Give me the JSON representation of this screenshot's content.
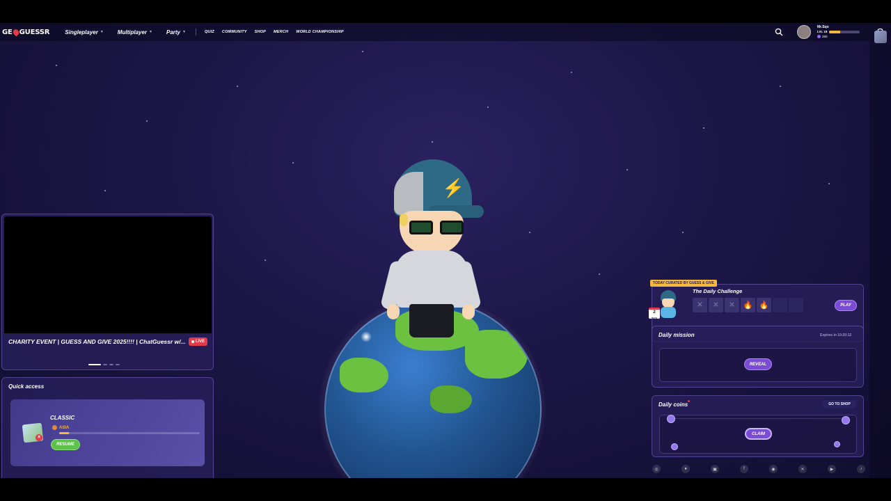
{
  "nav": {
    "logo": "GEOGUESSR",
    "main": [
      "Singleplayer",
      "Multiplayer",
      "Party"
    ],
    "sub": [
      "QUIZ",
      "COMMUNITY",
      "SHOP",
      "MERCH",
      "WORLD CHAMPIONSHIP"
    ]
  },
  "profile": {
    "name": "Mr.Sqo",
    "level": "LVL 18",
    "coins": "260",
    "level_progress": 0.35
  },
  "stream": {
    "title": "CHARITY EVENT | GUESS AND GIVE 2025!!!! | ChatGuessr w/...",
    "live_label": "LIVE"
  },
  "quick_access": {
    "label": "Quick access",
    "card": {
      "title": "CLASSIC",
      "region": "ASIA",
      "resume_label": "RESUME",
      "progress": 0.07
    }
  },
  "daily_challenge": {
    "tag": "TODAY CURATED BY GUESS & GIVE",
    "title": "The Daily Challenge",
    "calendar_num": "2",
    "calendar_sub": "DAYS",
    "streak": [
      "✕",
      "✕",
      "✕",
      "🔥",
      "🔥",
      "",
      ""
    ],
    "play_label": "PLAY"
  },
  "daily_mission": {
    "label": "Daily mission",
    "expires": "Expires in 10:20:12",
    "reveal_label": "REVEAL"
  },
  "daily_coins": {
    "label": "Daily coins",
    "shop_label": "GO TO SHOP",
    "claim_label": "CLAIM"
  },
  "socials": [
    "discord",
    "reddit",
    "twitch",
    "facebook",
    "instagram",
    "x",
    "youtube",
    "tiktok"
  ],
  "colors": {
    "accent": "#7b4bd6",
    "gold": "#f5b940",
    "live": "#e23b4c",
    "resume": "#5cc24a"
  }
}
